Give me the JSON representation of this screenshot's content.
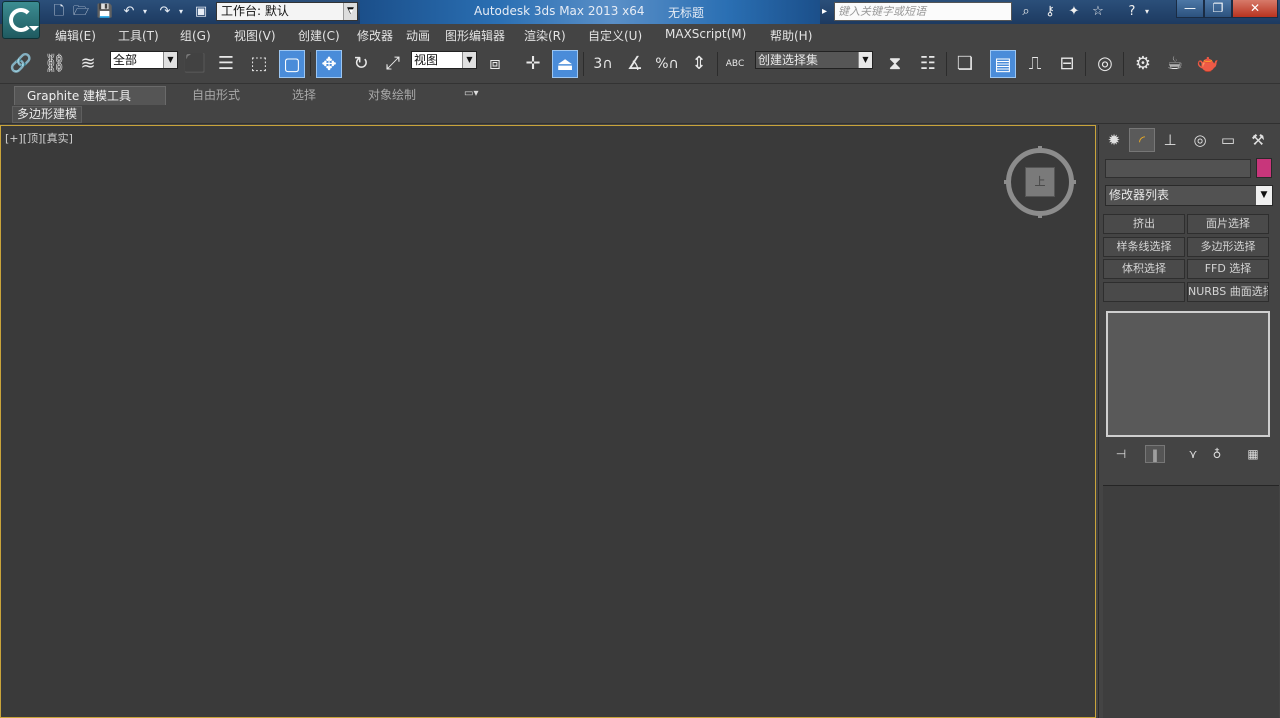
{
  "titlebar": {
    "workspace": "工作台: 默认",
    "app_title": "Autodesk 3ds Max  2013 x64",
    "document": "无标题",
    "search_placeholder": "键入关键字或短语",
    "quick_access": [
      "new-icon",
      "open-icon",
      "save-icon",
      "undo-icon",
      "redo-icon",
      "project-folder-icon"
    ],
    "info_icons": [
      "binoculars-icon",
      "key-icon",
      "star-cross-icon",
      "favorites-star-icon",
      "help-icon"
    ],
    "window_controls": [
      "minimize",
      "maximize",
      "close"
    ]
  },
  "menu": {
    "items": [
      "编辑(E)",
      "工具(T)",
      "组(G)",
      "视图(V)",
      "创建(C)",
      "修改器",
      "动画",
      "图形编辑器",
      "渲染(R)",
      "自定义(U)",
      "MAXScript(M)",
      "帮助(H)"
    ]
  },
  "toolbar": {
    "selection_filter": "全部",
    "ref_coord": "视图",
    "named_selection": "创建选择集",
    "snap_angle_label": "3",
    "percent_snap_label": "%",
    "text_abc": "ABC"
  },
  "ribbon": {
    "tabs": [
      "Graphite 建模工具",
      "自由形式",
      "选择",
      "对象绘制"
    ],
    "active_tab": "Graphite 建模工具",
    "subpanel": "多边形建模"
  },
  "viewport": {
    "label": "[+][顶][真实]",
    "viewcube_face": "上",
    "border_color": "#c9a43a",
    "background": "#3a3a3a"
  },
  "cmdpanel": {
    "tabs": [
      "create-tab",
      "modify-tab",
      "hierarchy-tab",
      "motion-tab",
      "display-tab",
      "utilities-tab"
    ],
    "name_value": "",
    "object_color": "#c8367b",
    "modifier_list": "修改器列表",
    "modifier_buttons": [
      "挤出",
      "面片选择",
      "样条线选择",
      "多边形选择",
      "体积选择",
      "FFD 选择",
      "",
      "NURBS 曲面选择"
    ]
  }
}
